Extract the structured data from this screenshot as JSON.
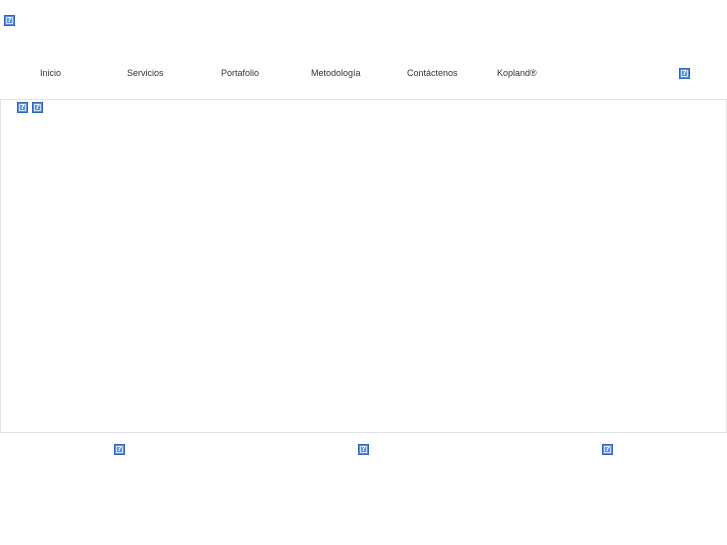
{
  "header": {
    "logo_icon": "broken-image-icon",
    "right_icon": "broken-image-icon"
  },
  "nav": {
    "items": [
      {
        "label": "Inicio"
      },
      {
        "label": "Servicios"
      },
      {
        "label": "Portafolio"
      },
      {
        "label": "Metodología"
      },
      {
        "label": "Contáctenos"
      },
      {
        "label": "Kopland®"
      }
    ]
  },
  "slider": {
    "control_icons": [
      "broken-image-icon",
      "broken-image-icon"
    ]
  },
  "footer": {
    "icons": [
      "broken-image-icon",
      "broken-image-icon",
      "broken-image-icon"
    ]
  },
  "colors": {
    "placeholder_fill": "#5b8fe0",
    "placeholder_border": "#2f62b8",
    "frame_border": "#e2e2e2",
    "nav_text": "#333333"
  }
}
